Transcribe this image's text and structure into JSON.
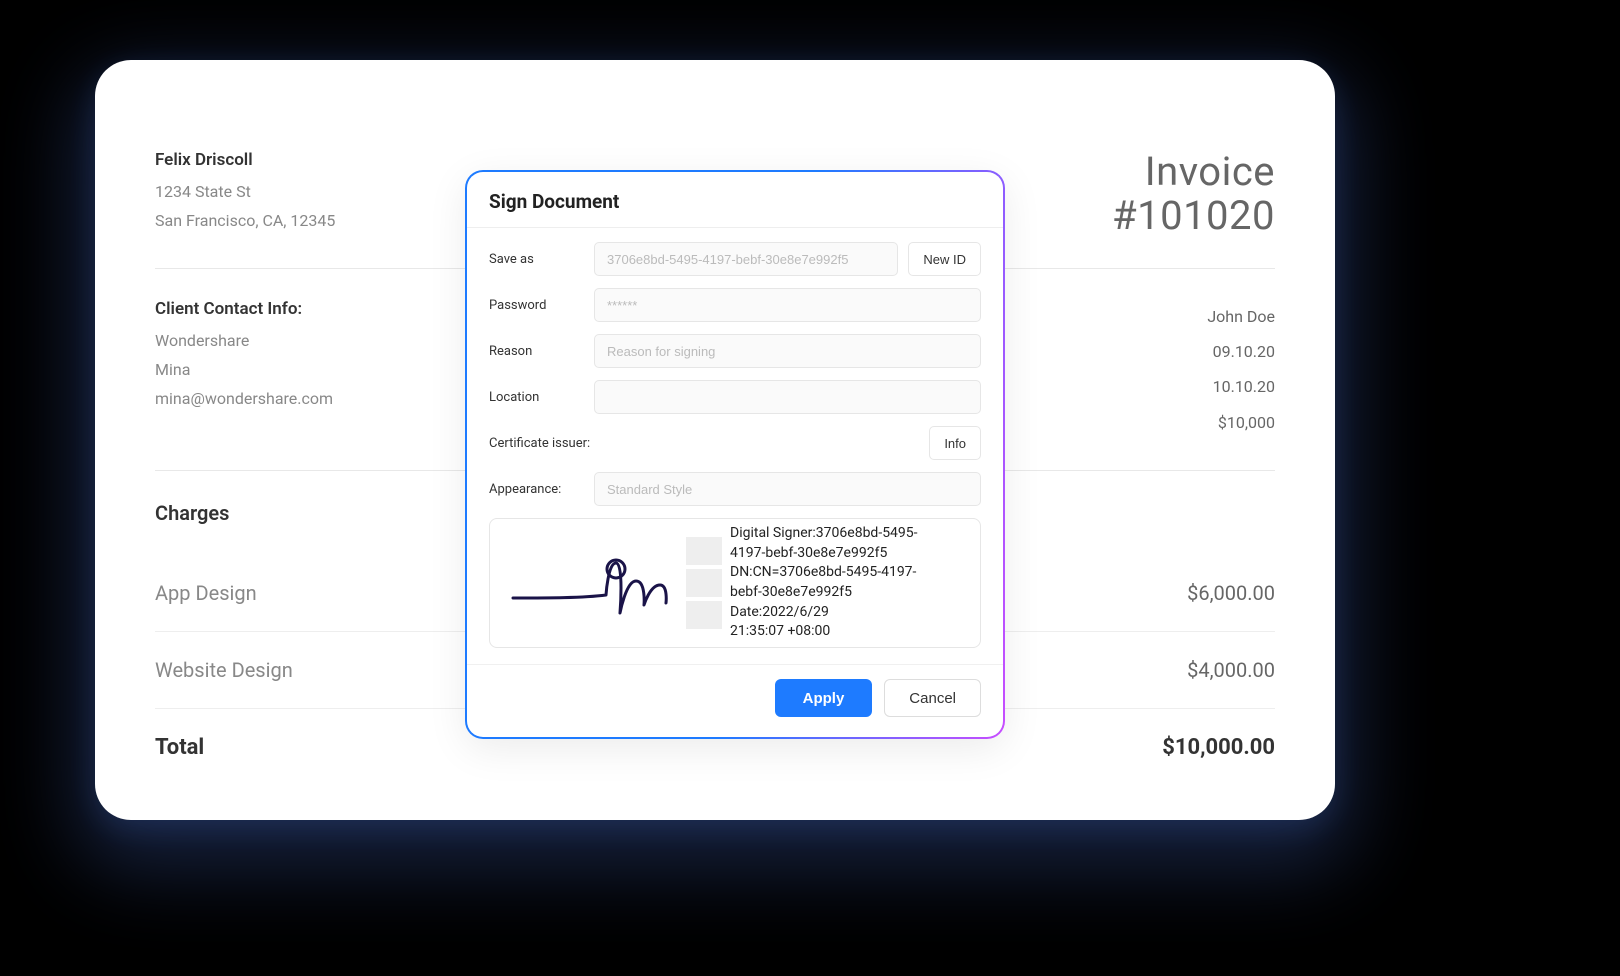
{
  "invoice": {
    "sender": {
      "name": "Felix Driscoll",
      "addr1": "1234 State St",
      "addr2": "San Francisco, CA, 12345"
    },
    "title_line1": "Invoice",
    "title_line2": "#101020",
    "client_label": "Client Contact Info:",
    "client": {
      "company": "Wondershare",
      "contact": "Mina",
      "email": "mina@wondershare.com"
    },
    "meta": {
      "name": "John Doe",
      "date1": "09.10.20",
      "date2": "10.10.20",
      "amount": "$10,000"
    },
    "charges_heading": "Charges",
    "charges": [
      {
        "label": "App Design",
        "amount": "$6,000.00"
      },
      {
        "label": "Website Design",
        "amount": "$4,000.00"
      }
    ],
    "total_label": "Total",
    "total_amount": "$10,000.00"
  },
  "dialog": {
    "title": "Sign Document",
    "save_as_label": "Save as",
    "save_as_placeholder": "3706e8bd-5495-4197-bebf-30e8e7e992f5",
    "new_id_label": "New ID",
    "password_label": "Password",
    "password_placeholder": "******",
    "reason_label": "Reason",
    "reason_placeholder": "Reason for signing",
    "location_label": "Location",
    "cert_issuer_label": "Certificate issuer:",
    "info_label": "Info",
    "appearance_label": "Appearance:",
    "appearance_placeholder": "Standard Style",
    "signature_details": "Digital Signer:3706e8bd-5495-\n4197-bebf-30e8e7e992f5\nDN:CN=3706e8bd-5495-4197-\nbebf-30e8e7e992f5\nDate:2022/6/29\n 21:35:07 +08:00",
    "apply_label": "Apply",
    "cancel_label": "Cancel"
  }
}
